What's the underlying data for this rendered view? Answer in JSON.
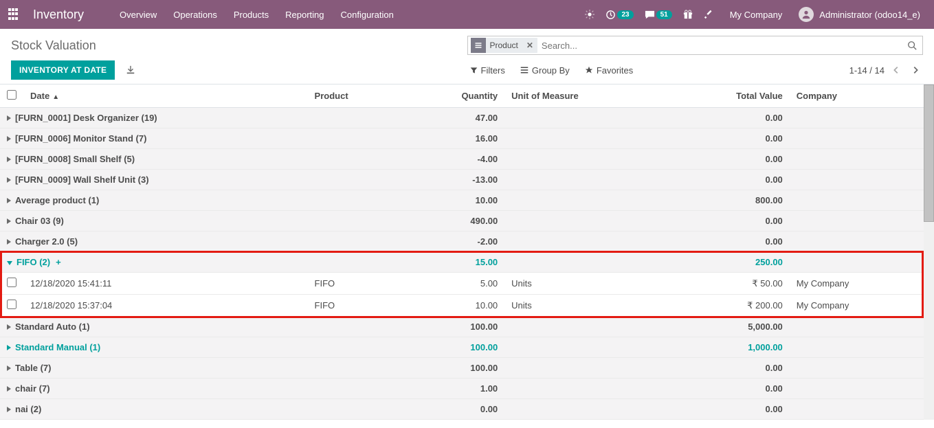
{
  "nav": {
    "app": "Inventory",
    "items": [
      "Overview",
      "Operations",
      "Products",
      "Reporting",
      "Configuration"
    ],
    "badge1": "23",
    "badge2": "51",
    "company": "My Company",
    "user": "Administrator (odoo14_e)"
  },
  "page": {
    "title": "Stock Valuation",
    "primary_button": "Inventory at Date",
    "search_facet": "Product",
    "search_placeholder": "Search...",
    "filters_label": "Filters",
    "groupby_label": "Group By",
    "favorites_label": "Favorites",
    "pager": "1-14 / 14"
  },
  "columns": {
    "date": "Date",
    "product": "Product",
    "qty": "Quantity",
    "uom": "Unit of Measure",
    "total": "Total Value",
    "company": "Company"
  },
  "groups": [
    {
      "label": "[FURN_0001] Desk Organizer (19)",
      "qty": "47.00",
      "total": "0.00"
    },
    {
      "label": "[FURN_0006] Monitor Stand (7)",
      "qty": "16.00",
      "total": "0.00"
    },
    {
      "label": "[FURN_0008] Small Shelf (5)",
      "qty": "-4.00",
      "total": "0.00"
    },
    {
      "label": "[FURN_0009] Wall Shelf Unit (3)",
      "qty": "-13.00",
      "total": "0.00"
    },
    {
      "label": "Average product (1)",
      "qty": "10.00",
      "total": "800.00"
    },
    {
      "label": "Chair 03 (9)",
      "qty": "490.00",
      "total": "0.00"
    },
    {
      "label": "Charger 2.0 (5)",
      "qty": "-2.00",
      "total": "0.00"
    },
    {
      "label": "FIFO (2)",
      "qty": "15.00",
      "total": "250.00",
      "expanded": true,
      "rows": [
        {
          "date": "12/18/2020 15:41:11",
          "product": "FIFO",
          "qty": "5.00",
          "uom": "Units",
          "total": "₹ 50.00",
          "company": "My Company"
        },
        {
          "date": "12/18/2020 15:37:04",
          "product": "FIFO",
          "qty": "10.00",
          "uom": "Units",
          "total": "₹ 200.00",
          "company": "My Company"
        }
      ]
    },
    {
      "label": "Standard Auto (1)",
      "qty": "100.00",
      "total": "5,000.00"
    },
    {
      "label": "Standard Manual (1)",
      "qty": "100.00",
      "total": "1,000.00",
      "teal": true
    },
    {
      "label": "Table (7)",
      "qty": "100.00",
      "total": "0.00"
    },
    {
      "label": "chair (7)",
      "qty": "1.00",
      "total": "0.00"
    },
    {
      "label": "nai (2)",
      "qty": "0.00",
      "total": "0.00"
    }
  ]
}
